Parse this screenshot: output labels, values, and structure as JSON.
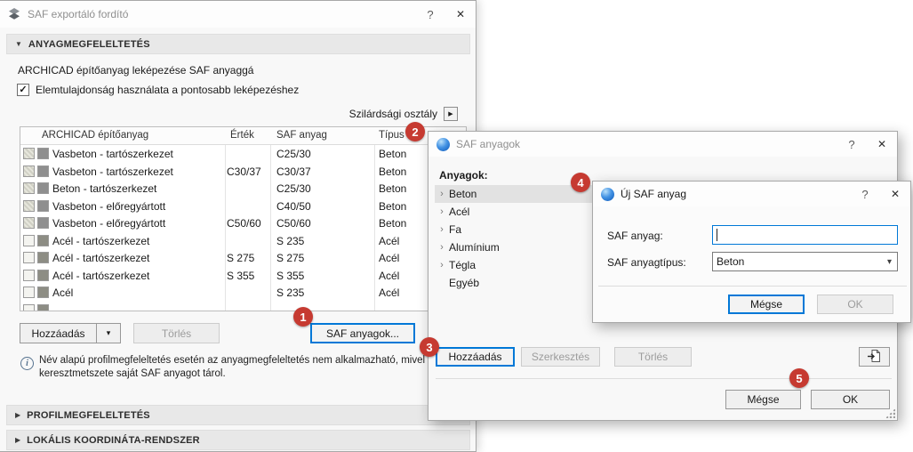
{
  "colors": {
    "accent_blue": "#0078d7",
    "badge_red": "#c63a31",
    "selected_row_gray": "#e2e2e2",
    "concrete_swatch": "#8f8f8f",
    "steel_swatch": "#8d8d84"
  },
  "glyphs": {
    "expanded": "▼",
    "collapsed": "▶",
    "dropdown": "▾",
    "check": "✓",
    "chevron": "›",
    "help": "?",
    "close": "✕",
    "info": "i"
  },
  "badges": [
    "1",
    "2",
    "3",
    "4",
    "5"
  ],
  "main_dialog": {
    "title": "SAF exportáló fordító",
    "material_section": {
      "label": "ANYAGMEGFELELTETÉS",
      "description": "ARCHICAD építőanyag leképezése SAF anyaggá",
      "checkbox_label": "Elemtulajdonság használata a pontosabb leképezéshez",
      "checkbox_checked": true,
      "strength_class_label": "Szilárdsági osztály",
      "table": {
        "columns": [
          "ARCHICAD építőanyag",
          "Érték",
          "SAF anyag",
          "Típus"
        ],
        "rows": [
          {
            "name": "Vasbeton - tartószerkezet",
            "value": "",
            "saf_material": "C25/30",
            "type": "Beton"
          },
          {
            "name": "Vasbeton - tartószerkezet",
            "value": "C30/37",
            "saf_material": "C30/37",
            "type": "Beton"
          },
          {
            "name": "Beton - tartószerkezet",
            "value": "",
            "saf_material": "C25/30",
            "type": "Beton"
          },
          {
            "name": "Vasbeton - előregyártott",
            "value": "",
            "saf_material": "C40/50",
            "type": "Beton"
          },
          {
            "name": "Vasbeton - előregyártott",
            "value": "C50/60",
            "saf_material": "C50/60",
            "type": "Beton"
          },
          {
            "name": "Acél - tartószerkezet",
            "value": "",
            "saf_material": "S 235",
            "type": "Acél"
          },
          {
            "name": "Acél - tartószerkezet",
            "value": "S 275",
            "saf_material": "S 275",
            "type": "Acél"
          },
          {
            "name": "Acél - tartószerkezet",
            "value": "S 355",
            "saf_material": "S 355",
            "type": "Acél"
          },
          {
            "name": "Acél",
            "value": "",
            "saf_material": "S 235",
            "type": "Acél"
          },
          {
            "name": "",
            "value": "",
            "saf_material": "",
            "type": ""
          }
        ]
      },
      "add_button": "Hozzáadás",
      "delete_button": "Törlés",
      "saf_materials_button": "SAF anyagok...",
      "info_line1": "Név alapú profilmegfeleltetés esetén az anyagmegfeleltetés nem alkalmazható, mivel",
      "info_line2": "keresztmetszete saját SAF anyagot tárol."
    },
    "profile_section_label": "PROFILMEGFELELTETÉS",
    "coords_section_label": "LOKÁLIS KOORDINÁTA-RENDSZER"
  },
  "saf_materials_dialog": {
    "title": "SAF anyagok",
    "materials_label": "Anyagok:",
    "selected_material": "Beton",
    "materials": [
      {
        "label": "Beton"
      },
      {
        "label": "Acél"
      },
      {
        "label": "Fa"
      },
      {
        "label": "Alumínium"
      },
      {
        "label": "Tégla"
      },
      {
        "label": "Egyéb"
      }
    ],
    "add_button": "Hozzáadás",
    "edit_button": "Szerkesztés",
    "delete_button": "Törlés",
    "cancel_button": "Mégse",
    "ok_button": "OK"
  },
  "new_material_dialog": {
    "title": "Új SAF anyag",
    "name_label": "SAF anyag:",
    "name_value": "",
    "type_label": "SAF anyagtípus:",
    "type_value": "Beton",
    "cancel_button": "Mégse",
    "ok_button": "OK"
  }
}
